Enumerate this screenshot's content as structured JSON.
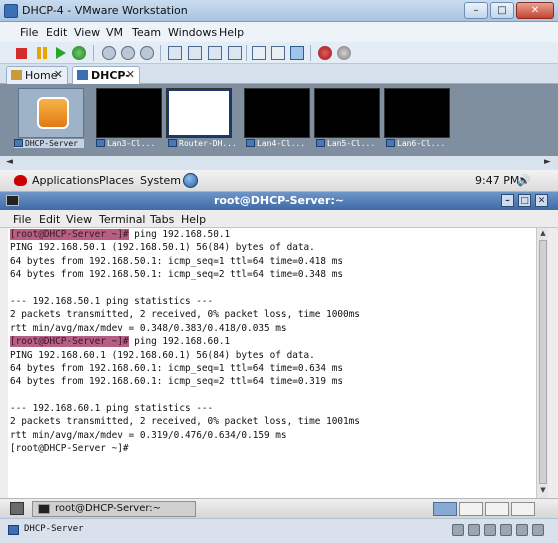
{
  "vmware": {
    "title": "DHCP-4 - VMware Workstation",
    "window_buttons": [
      "–",
      "□",
      "✕"
    ],
    "menu": [
      "File",
      "Edit",
      "View",
      "VM",
      "Team",
      "Windows",
      "Help"
    ],
    "tabs": [
      {
        "label": "Home",
        "close": "✕"
      },
      {
        "label": "DHCP-4",
        "close": "✕"
      }
    ],
    "thumbnails": [
      "DHCP-Server",
      "Lan3-Cl...",
      "Router-DH...",
      "Lan4-Cl...",
      "Lan5-Cl...",
      "Lan6-Cl..."
    ],
    "thumb_scroll": [
      "◄",
      "►"
    ],
    "status_label": "DHCP-Server"
  },
  "guest": {
    "panel": {
      "applications": "Applications",
      "places": "Places",
      "system": "System",
      "clock": "9:47 PM",
      "volume_icon": "🔊"
    },
    "terminal": {
      "title": "root@DHCP-Server:~",
      "title_buttons": [
        "–",
        "□",
        "✕"
      ],
      "menu": [
        "File",
        "Edit",
        "View",
        "Terminal",
        "Tabs",
        "Help"
      ],
      "lines": [
        {
          "prompt": "[root@DHCP-Server ~]#",
          "text": " ping 192.168.50.1"
        },
        {
          "prompt": "",
          "text": "PING 192.168.50.1 (192.168.50.1) 56(84) bytes of data."
        },
        {
          "prompt": "",
          "text": "64 bytes from 192.168.50.1: icmp_seq=1 ttl=64 time=0.418 ms"
        },
        {
          "prompt": "",
          "text": "64 bytes from 192.168.50.1: icmp_seq=2 ttl=64 time=0.348 ms"
        },
        {
          "prompt": "",
          "text": ""
        },
        {
          "prompt": "",
          "text": "--- 192.168.50.1 ping statistics ---"
        },
        {
          "prompt": "",
          "text": "2 packets transmitted, 2 received, 0% packet loss, time 1000ms"
        },
        {
          "prompt": "",
          "text": "rtt min/avg/max/mdev = 0.348/0.383/0.418/0.035 ms"
        },
        {
          "prompt": "[root@DHCP-Server ~]#",
          "text": " ping 192.168.60.1"
        },
        {
          "prompt": "",
          "text": "PING 192.168.60.1 (192.168.60.1) 56(84) bytes of data."
        },
        {
          "prompt": "",
          "text": "64 bytes from 192.168.60.1: icmp_seq=1 ttl=64 time=0.634 ms"
        },
        {
          "prompt": "",
          "text": "64 bytes from 192.168.60.1: icmp_seq=2 ttl=64 time=0.319 ms"
        },
        {
          "prompt": "",
          "text": ""
        },
        {
          "prompt": "",
          "text": "--- 192.168.60.1 ping statistics ---"
        },
        {
          "prompt": "",
          "text": "2 packets transmitted, 2 received, 0% packet loss, time 1001ms"
        },
        {
          "prompt": "",
          "text": "rtt min/avg/max/mdev = 0.319/0.476/0.634/0.159 ms"
        },
        {
          "prompt": "",
          "text": "[root@DHCP-Server ~]#"
        }
      ],
      "scroll_arrows": [
        "▲",
        "▼"
      ]
    },
    "taskbar": {
      "task_label": "root@DHCP-Server:~"
    }
  },
  "colors": {
    "prompt_highlight": "#b75f83",
    "terminal_title": "#3e6aa7"
  }
}
